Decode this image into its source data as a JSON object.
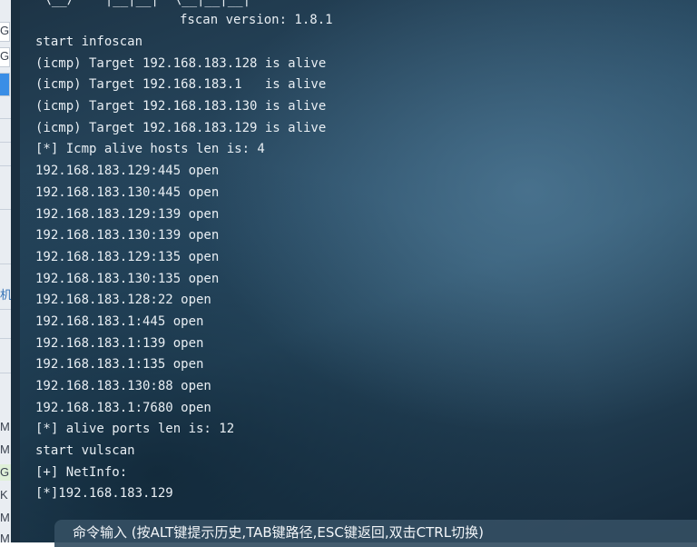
{
  "left_strip": {
    "fragments": [
      "G",
      "G",
      "",
      "",
      "",
      "",
      "",
      "",
      "",
      "",
      "",
      "机",
      "",
      "",
      "",
      "",
      "M",
      "M",
      "G",
      "K",
      "M",
      "M"
    ]
  },
  "terminal": {
    "banner": " \\__/    |__|__|  \\__|__|__|  ",
    "version": "fscan version: 1.8.1",
    "lines": [
      "start infoscan",
      "(icmp) Target 192.168.183.128 is alive",
      "(icmp) Target 192.168.183.1   is alive",
      "(icmp) Target 192.168.183.130 is alive",
      "(icmp) Target 192.168.183.129 is alive",
      "[*] Icmp alive hosts len is: 4",
      "192.168.183.129:445 open",
      "192.168.183.130:445 open",
      "192.168.183.129:139 open",
      "192.168.183.130:139 open",
      "192.168.183.129:135 open",
      "192.168.183.130:135 open",
      "192.168.183.128:22 open",
      "192.168.183.1:445 open",
      "192.168.183.1:139 open",
      "192.168.183.1:135 open",
      "192.168.183.130:88 open",
      "192.168.183.1:7680 open",
      "[*] alive ports len is: 12",
      "start vulscan",
      "[+] NetInfo:",
      "[*]192.168.183.129"
    ],
    "command_bar": {
      "label": "命令输入 (按ALT键提示历史,TAB键路径,ESC键返回,双击CTRL切换)"
    }
  },
  "colors": {
    "text": "#e8eef3",
    "background_dark": "#1d3446",
    "background_light": "#2e536c",
    "command_bar": "#344e62"
  }
}
